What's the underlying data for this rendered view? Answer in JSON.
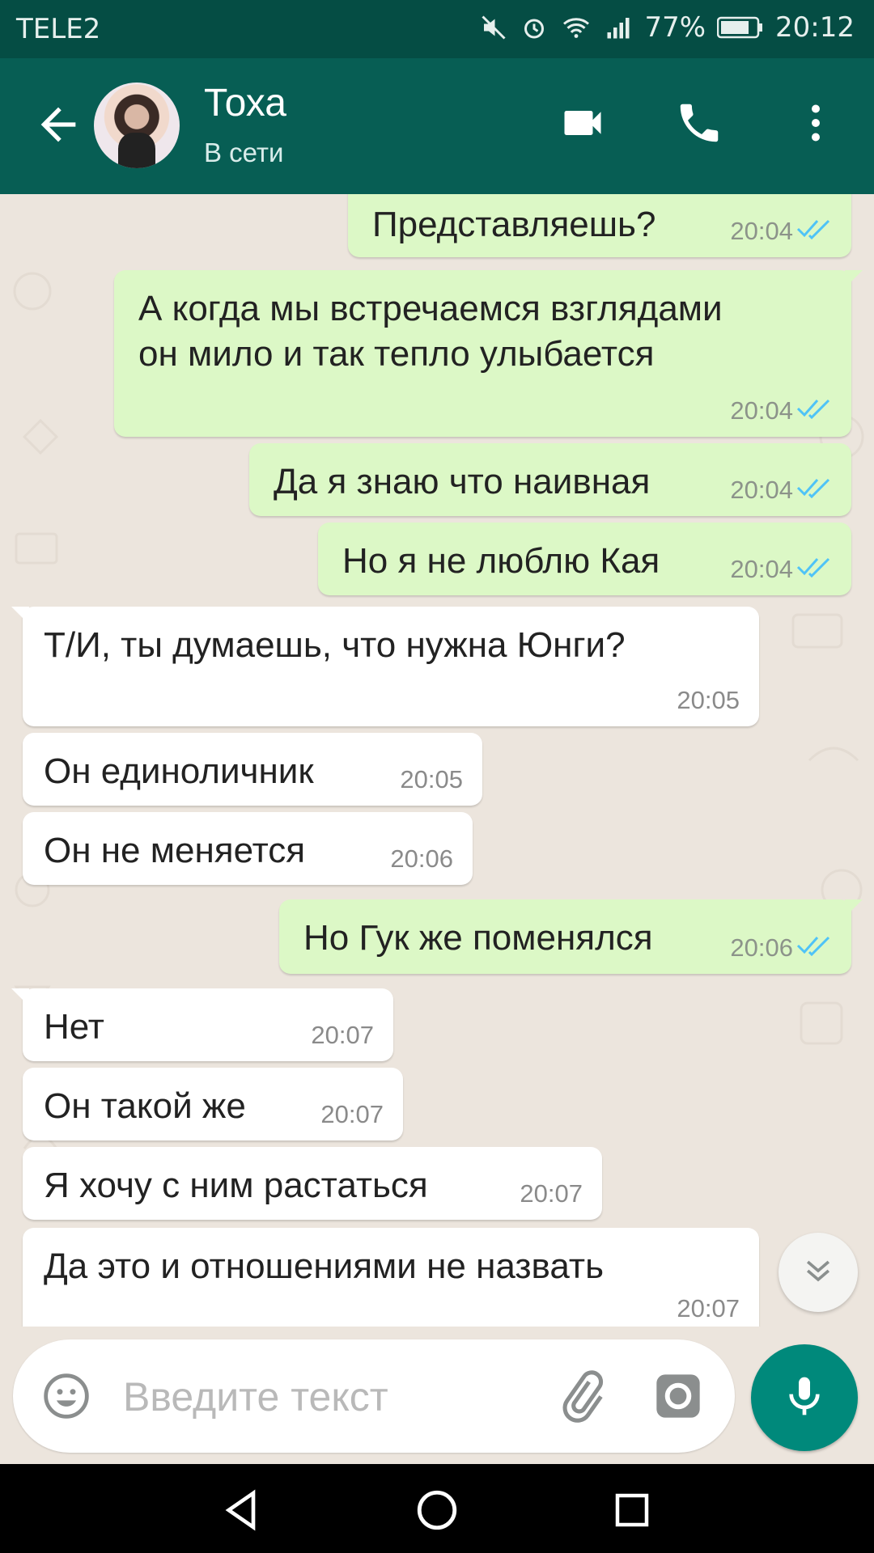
{
  "status": {
    "carrier": "TELE2",
    "battery": "77%",
    "time": "20:12"
  },
  "header": {
    "name": "Тоха",
    "status": "В сети"
  },
  "messages": [
    {
      "dir": "out",
      "text": "Представляешь?",
      "time": "20:04",
      "read": true
    },
    {
      "dir": "out",
      "text": "А когда мы встречаемся взглядами\nон мило и так тепло улыбается",
      "time": "20:04",
      "read": true
    },
    {
      "dir": "out",
      "text": "Да я знаю что наивная",
      "time": "20:04",
      "read": true
    },
    {
      "dir": "out",
      "text": "Но я не люблю Кая",
      "time": "20:04",
      "read": true
    },
    {
      "dir": "in",
      "text": "Т/И, ты думаешь, что нужна Юнги?",
      "time": "20:05"
    },
    {
      "dir": "in",
      "text": "Он единоличник",
      "time": "20:05"
    },
    {
      "dir": "in",
      "text": "Он не меняется",
      "time": "20:06"
    },
    {
      "dir": "out",
      "text": "Но Гук же поменялся",
      "time": "20:06",
      "read": true
    },
    {
      "dir": "in",
      "text": "Нет",
      "time": "20:07"
    },
    {
      "dir": "in",
      "text": "Он такой же",
      "time": "20:07"
    },
    {
      "dir": "in",
      "text": "Я хочу с ним растаться",
      "time": "20:07"
    },
    {
      "dir": "in",
      "text": "Да это и отношениями не назвать",
      "time": "20:07"
    }
  ],
  "composer": {
    "placeholder": "Введите текст"
  },
  "colors": {
    "header": "#075e54",
    "statusbar": "#054d44",
    "outgoing": "#dcf8c6",
    "incoming": "#ffffff",
    "accent": "#00897b",
    "read_ticks": "#4fc3f7"
  }
}
